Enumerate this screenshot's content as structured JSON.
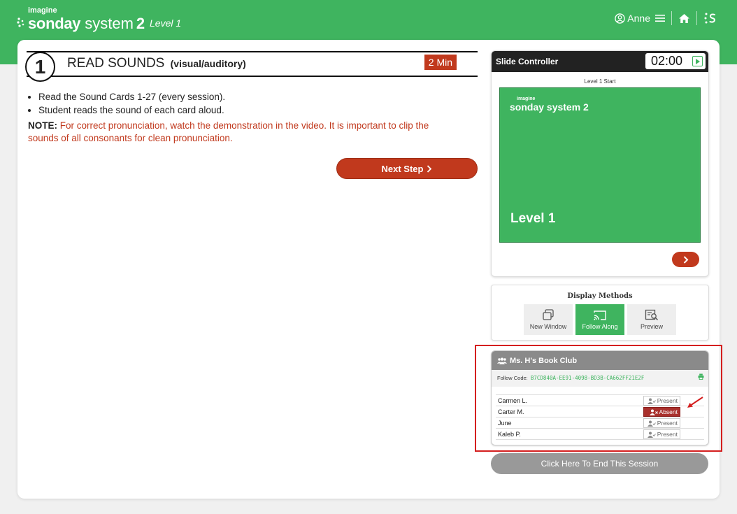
{
  "header": {
    "logo_small": "imagine",
    "logo_word1": "sonday",
    "logo_word2": "system",
    "logo_num": "2",
    "level": "Level 1",
    "user_name": "Anne"
  },
  "step": {
    "number": "1",
    "title": "READ SOUNDS",
    "subtitle": "(visual/auditory)",
    "duration": "2 Min",
    "bullets": [
      "Read the Sound Cards 1-27 (every session).",
      "Student reads the sound of each card aloud."
    ],
    "note_label": "NOTE:",
    "note_text": "For correct pronunciation, watch the demonstration in the video. It is important to clip the sounds of all consonants for clean pronunciation.",
    "next_label": "Next Step"
  },
  "slide_controller": {
    "title": "Slide Controller",
    "timer": "02:00",
    "caption": "Level 1 Start",
    "slide_logo_small": "imagine",
    "slide_logo_brand": "sonday system 2",
    "slide_level": "Level 1"
  },
  "display_methods": {
    "title": "Display Methods",
    "buttons": [
      {
        "label": "New Window",
        "icon": "new-window-icon",
        "active": false
      },
      {
        "label": "Follow Along",
        "icon": "cast-icon",
        "active": true
      },
      {
        "label": "Preview",
        "icon": "preview-icon",
        "active": false
      }
    ]
  },
  "club": {
    "name": "Ms. H's Book Club",
    "follow_label": "Follow Code:",
    "follow_code": "B7CD840A-EE91-4098-BD3B-CA662FF21E2F",
    "students": [
      {
        "name": "Carmen L.",
        "status": "Present"
      },
      {
        "name": "Carter M.",
        "status": "Absent"
      },
      {
        "name": "June",
        "status": "Present"
      },
      {
        "name": "Kaleb P.",
        "status": "Present"
      }
    ]
  },
  "end_session_label": "Click Here To End This Session",
  "colors": {
    "brand_green": "#3fb45f",
    "accent_red": "#c1391d",
    "absent_red": "#a9302c",
    "highlight_red": "#d41f1f"
  }
}
